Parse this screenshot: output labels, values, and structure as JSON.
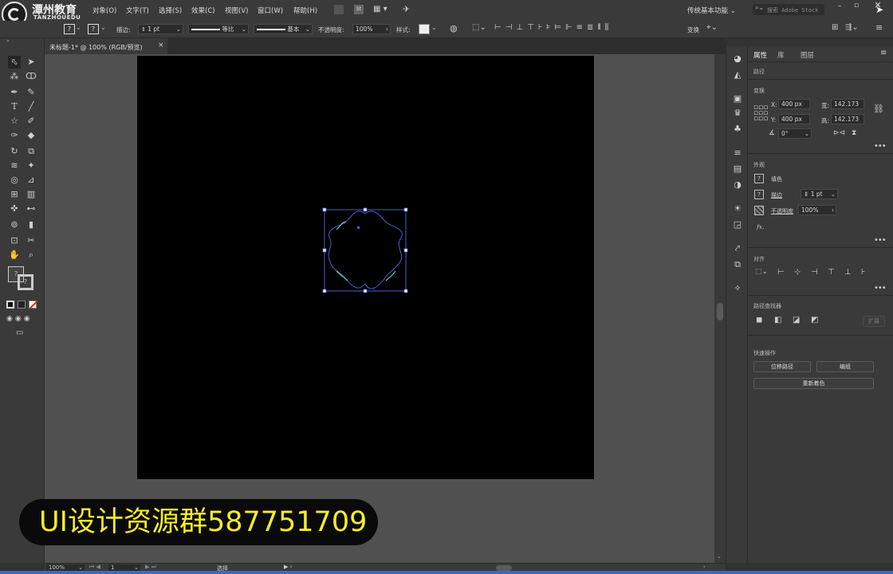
{
  "brand": {
    "name": "潭州教育",
    "sub": "TANZHOUEDU",
    "small_label": "路径"
  },
  "menu": [
    "对象(O)",
    "文字(T)",
    "选择(S)",
    "效果(C)",
    "视图(V)",
    "窗口(W)",
    "帮助(H)"
  ],
  "workspace": "传统基本功能",
  "search_placeholder": "搜索 Adobe Stock",
  "control": {
    "stroke_label": "描边:",
    "stroke_value": "1 pt",
    "profile1": "等比",
    "profile2": "基本",
    "opacity_label": "不透明度:",
    "opacity_value": "100%",
    "style_label": "样式:",
    "transform_label": "变换"
  },
  "doc_tab": {
    "title": "未标题-1* @ 100% (RGB/预览)",
    "close": "×"
  },
  "panel": {
    "tabs": [
      "属性",
      "库",
      "图层"
    ],
    "selection_type": "路径",
    "transform_title": "变换",
    "x_label": "X:",
    "x_value": "400 px",
    "y_label": "Y:",
    "y_value": "400 px",
    "w_label": "宽:",
    "w_value": "142.173",
    "h_label": "高:",
    "h_value": "142.173",
    "angle_value": "0°",
    "appearance_title": "外观",
    "fill_label": "填色",
    "stroke_label": "描边",
    "stroke_value": "1 pt",
    "opacity_label": "不透明度",
    "opacity_value": "100%",
    "fx_label": "fx.",
    "align_title": "对齐",
    "pathfinder_title": "路径查找器",
    "expand_label": "扩展",
    "quick_title": "快速操作",
    "btn_offset": "位移路径",
    "btn_group": "编组",
    "btn_recolor": "重新着色"
  },
  "status": {
    "zoom": "100%",
    "page": "1",
    "tool": "选择"
  },
  "watermark": "UI设计资源群587751709",
  "colors": {
    "accent_blue": "#4a5dc9",
    "path_green": "#59c29a",
    "watermark_yellow": "#f6ee2c"
  }
}
